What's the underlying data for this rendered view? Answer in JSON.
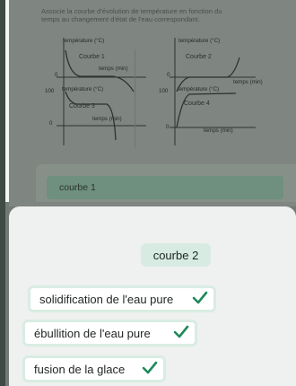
{
  "prompt": {
    "text": "Associe la courbe d'évolution de température en fonction du\ntemps au changement d'état de l'eau correspondant."
  },
  "graphs": [
    {
      "y_axis_label": "température (°C)",
      "x_axis_label": "temps (min)",
      "curve_title": "Courbe 1",
      "tick": "0"
    },
    {
      "y_axis_label": "température (°C)",
      "x_axis_label": "temps (min)",
      "curve_title": "Courbe 2",
      "tick": "0"
    },
    {
      "y_axis_label": "température (°C)",
      "x_axis_label": "temps (min)",
      "curve_title": "Courbe 3",
      "tick_top": "100",
      "tick": "0"
    },
    {
      "y_axis_label": "température (°C)",
      "x_axis_label": "temps (min)",
      "curve_title": "Courbe 4",
      "tick_top": "100",
      "tick": "0"
    }
  ],
  "selected_answer": {
    "label": "courbe 1"
  },
  "options": [
    {
      "label": "courbe 2"
    },
    {
      "label": "solidification de l'eau pure",
      "checked": true
    },
    {
      "label": "ébullition de l'eau pure",
      "checked": true
    },
    {
      "label": "fusion de la glace",
      "checked": true
    }
  ],
  "colors": {
    "accent": "#1f8a5c",
    "chip_bg": "#d7ebe2",
    "sheet_bg": "#eef1ef"
  },
  "icons": {
    "check": "check-icon"
  }
}
